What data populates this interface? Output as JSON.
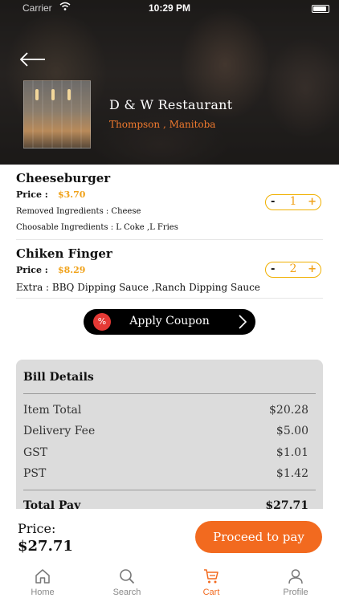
{
  "status_bar": {
    "carrier": "Carrier",
    "time": "10:29 PM"
  },
  "restaurant": {
    "name": "D & W Restaurant",
    "location": "Thompson , Manitoba"
  },
  "cart_items": [
    {
      "name": "Cheeseburger",
      "price_label": "Price :",
      "price": "$3.70",
      "details": [
        "Removed Ingredients : Cheese",
        "Choosable Ingredients : L Coke ,L Fries"
      ],
      "quantity": "1",
      "minus": "-",
      "plus": "+"
    },
    {
      "name": "Chiken Finger",
      "price_label": "Price :",
      "price": "$8.29",
      "details": [
        "Extra : BBQ Dipping Sauce ,Ranch Dipping Sauce"
      ],
      "quantity": "2",
      "minus": "-",
      "plus": "+"
    }
  ],
  "coupon": {
    "label": "Apply Coupon",
    "badge": "%"
  },
  "bill": {
    "title": "Bill Details",
    "rows": [
      {
        "label": "Item Total",
        "value": "$20.28"
      },
      {
        "label": "Delivery Fee",
        "value": "$5.00"
      },
      {
        "label": "GST",
        "value": "$1.01"
      },
      {
        "label": "PST",
        "value": "$1.42"
      }
    ],
    "total": {
      "label": "Total Pay",
      "value": "$27.71"
    }
  },
  "pay": {
    "label": "Price:",
    "amount": "$27.71",
    "button": "Proceed to pay"
  },
  "tabs": [
    {
      "label": "Home",
      "icon": "home-icon"
    },
    {
      "label": "Search",
      "icon": "search-icon"
    },
    {
      "label": "Cart",
      "icon": "cart-icon",
      "active": true
    },
    {
      "label": "Profile",
      "icon": "profile-icon"
    }
  ],
  "colors": {
    "accent": "#f26a1f",
    "price": "#f0a21a",
    "coupon_badge": "#e53935"
  }
}
